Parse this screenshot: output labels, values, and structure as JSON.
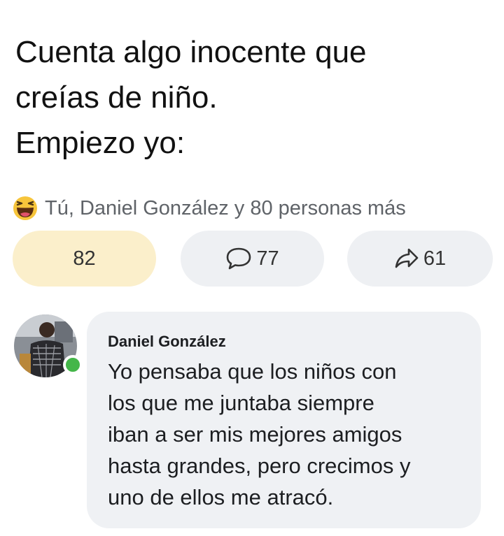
{
  "post": {
    "text_lines": [
      "Cuenta algo inocente que",
      "creías de niño.",
      "Empiezo yo:"
    ]
  },
  "reactions": {
    "icon": "haha-emoji-icon",
    "summary": "Tú, Daniel González y 80 personas más"
  },
  "actions": {
    "react_count": "82",
    "comment_count": "77",
    "share_count": "61",
    "icons": {
      "comment": "speech-bubble-icon",
      "share": "share-arrow-icon"
    },
    "colors": {
      "react_bg": "#fbefcb",
      "neutral_bg": "#eef0f3"
    }
  },
  "comment": {
    "author": "Daniel González",
    "online_status_color": "#44b649",
    "text_lines": [
      "Yo pensaba que los niños con",
      "los que me juntaba siempre",
      "iban a ser mis mejores amigos",
      "hasta grandes, pero crecimos y",
      "uno de ellos me atracó."
    ]
  }
}
